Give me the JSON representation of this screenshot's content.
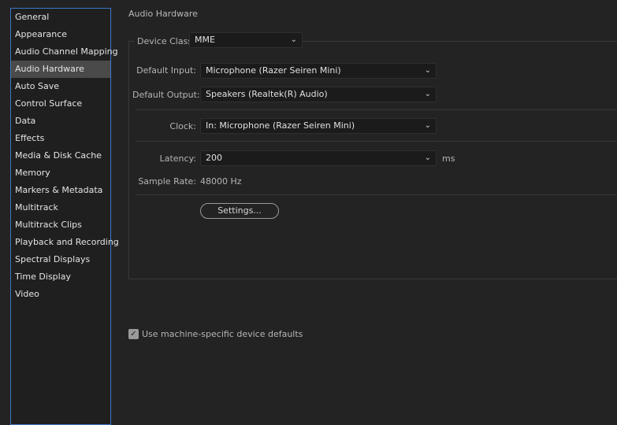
{
  "sidebar": {
    "items": [
      {
        "label": "General"
      },
      {
        "label": "Appearance"
      },
      {
        "label": "Audio Channel Mapping"
      },
      {
        "label": "Audio Hardware",
        "selected": true
      },
      {
        "label": "Auto Save"
      },
      {
        "label": "Control Surface"
      },
      {
        "label": "Data"
      },
      {
        "label": "Effects"
      },
      {
        "label": "Media & Disk Cache"
      },
      {
        "label": "Memory"
      },
      {
        "label": "Markers & Metadata"
      },
      {
        "label": "Multitrack"
      },
      {
        "label": "Multitrack Clips"
      },
      {
        "label": "Playback and Recording"
      },
      {
        "label": "Spectral Displays"
      },
      {
        "label": "Time Display"
      },
      {
        "label": "Video"
      }
    ]
  },
  "section_title": "Audio Hardware",
  "device_class": {
    "label": "Device Class:",
    "value": "MME"
  },
  "default_input": {
    "label": "Default Input:",
    "value": "Microphone (Razer Seiren Mini)"
  },
  "default_output": {
    "label": "Default Output:",
    "value": "Speakers (Realtek(R) Audio)"
  },
  "clock": {
    "label": "Clock:",
    "value": "In: Microphone (Razer Seiren Mini)"
  },
  "latency": {
    "label": "Latency:",
    "value": "200",
    "unit": "ms"
  },
  "sample_rate": {
    "label": "Sample Rate:",
    "value": "48000 Hz"
  },
  "settings_button": "Settings...",
  "machine_defaults": {
    "label": "Use machine-specific device defaults",
    "checked": true
  },
  "icons": {
    "dropdown": "chevron-down-icon",
    "check": "checkmark-icon"
  },
  "colors": {
    "accent_border": "#3c78c8",
    "selected_bg": "#4a4a4a",
    "background": "#232323"
  }
}
